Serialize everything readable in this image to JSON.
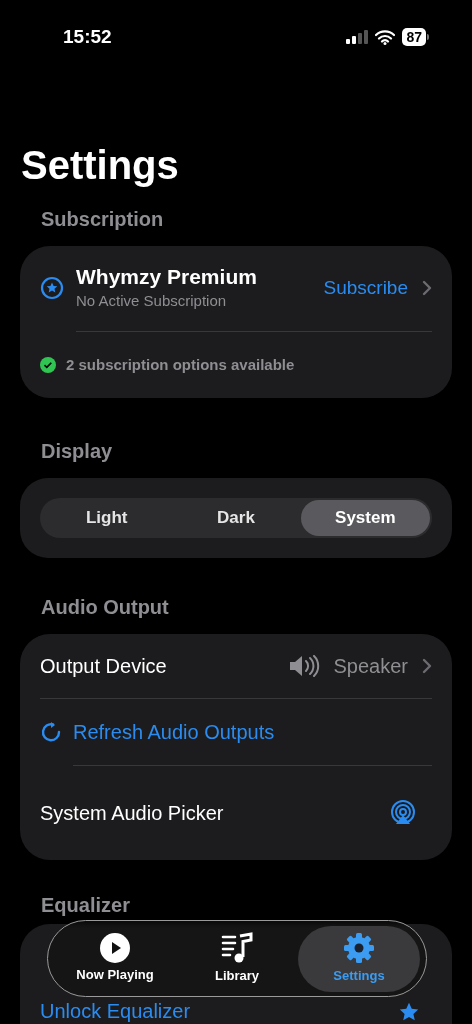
{
  "status_bar": {
    "time": "15:52",
    "battery": "87"
  },
  "title": "Settings",
  "subscription": {
    "header": "Subscription",
    "name": "Whymzy Premium",
    "status": "No Active Subscription",
    "action": "Subscribe",
    "note": "2 subscription options available"
  },
  "display": {
    "header": "Display",
    "options": [
      {
        "label": "Light",
        "selected": false
      },
      {
        "label": "Dark",
        "selected": false
      },
      {
        "label": "System",
        "selected": true
      }
    ]
  },
  "audio_output": {
    "header": "Audio Output",
    "rows": [
      {
        "kind": "value",
        "label": "Output Device",
        "value": "Speaker"
      },
      {
        "kind": "action",
        "label": "Refresh Audio Outputs"
      },
      {
        "kind": "picker",
        "label": "System Audio Picker"
      }
    ]
  },
  "equalizer": {
    "header": "Equalizer",
    "rows": [
      {
        "kind": "action",
        "label": "Unlock Equalizer"
      }
    ]
  },
  "tab_bar": [
    {
      "label": "Now Playing",
      "selected": false
    },
    {
      "label": "Library",
      "selected": false
    },
    {
      "label": "Settings",
      "selected": true
    }
  ]
}
